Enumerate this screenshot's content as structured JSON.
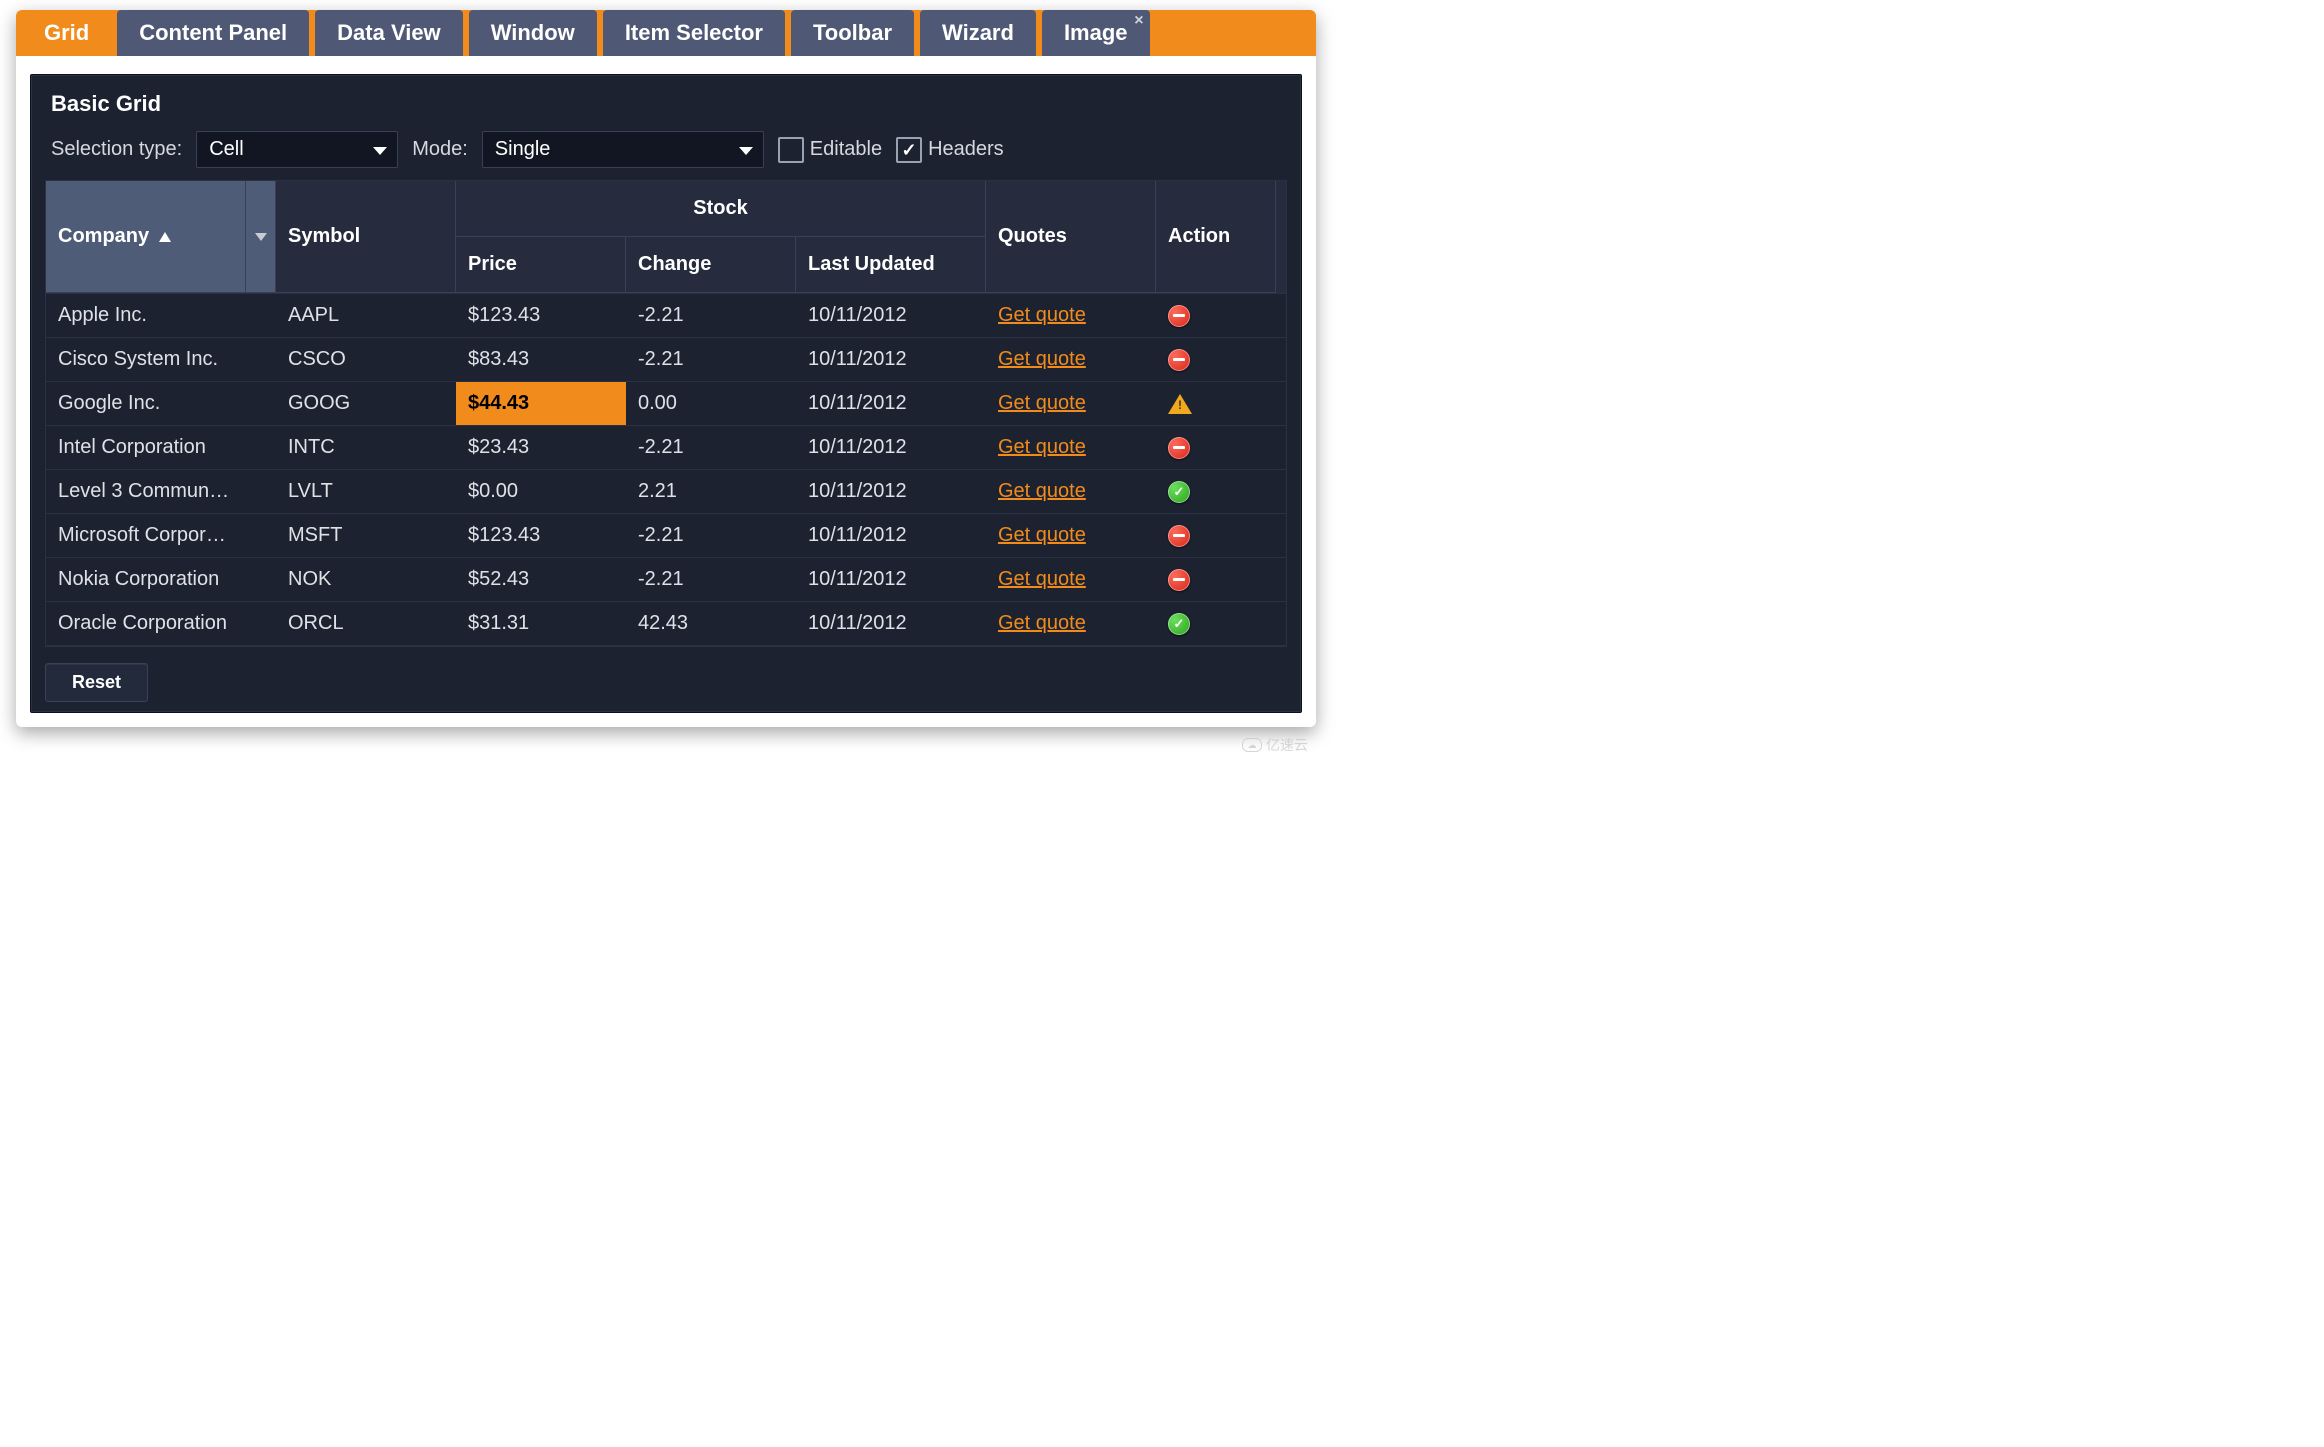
{
  "tabs": {
    "items": [
      {
        "label": "Grid"
      },
      {
        "label": "Content Panel"
      },
      {
        "label": "Data View"
      },
      {
        "label": "Window"
      },
      {
        "label": "Item Selector"
      },
      {
        "label": "Toolbar"
      },
      {
        "label": "Wizard"
      },
      {
        "label": "Image"
      }
    ],
    "close_glyph": "×"
  },
  "panel": {
    "title": "Basic Grid"
  },
  "toolbar": {
    "selection_type_label": "Selection type:",
    "selection_type_value": "Cell",
    "mode_label": "Mode:",
    "mode_value": "Single",
    "editable_label": "Editable",
    "editable_checked": false,
    "headers_label": "Headers",
    "headers_checked": true
  },
  "grid": {
    "headers": {
      "company": "Company",
      "symbol": "Symbol",
      "stock_group": "Stock",
      "price": "Price",
      "change": "Change",
      "last_updated": "Last Updated",
      "quotes": "Quotes",
      "action": "Action"
    },
    "quote_link_label": "Get quote",
    "rows": [
      {
        "company": "Apple Inc.",
        "symbol": "AAPL",
        "price": "$123.43",
        "change": "-2.21",
        "updated": "10/11/2012",
        "status": "minus",
        "hl": false
      },
      {
        "company": "Cisco System Inc.",
        "symbol": "CSCO",
        "price": "$83.43",
        "change": "-2.21",
        "updated": "10/11/2012",
        "status": "minus",
        "hl": false
      },
      {
        "company": "Google Inc.",
        "symbol": "GOOG",
        "price": "$44.43",
        "change": "0.00",
        "updated": "10/11/2012",
        "status": "warn",
        "hl": true
      },
      {
        "company": "Intel Corporation",
        "symbol": "INTC",
        "price": "$23.43",
        "change": "-2.21",
        "updated": "10/11/2012",
        "status": "minus",
        "hl": false
      },
      {
        "company": "Level 3 Commun…",
        "symbol": "LVLT",
        "price": "$0.00",
        "change": "2.21",
        "updated": "10/11/2012",
        "status": "check",
        "hl": false
      },
      {
        "company": "Microsoft Corpor…",
        "symbol": "MSFT",
        "price": "$123.43",
        "change": "-2.21",
        "updated": "10/11/2012",
        "status": "minus",
        "hl": false
      },
      {
        "company": "Nokia Corporation",
        "symbol": "NOK",
        "price": "$52.43",
        "change": "-2.21",
        "updated": "10/11/2012",
        "status": "minus",
        "hl": false
      },
      {
        "company": "Oracle Corporation",
        "symbol": "ORCL",
        "price": "$31.31",
        "change": "42.43",
        "updated": "10/11/2012",
        "status": "check",
        "hl": false
      }
    ]
  },
  "footer": {
    "reset_label": "Reset"
  },
  "watermark": {
    "text": "亿速云"
  }
}
